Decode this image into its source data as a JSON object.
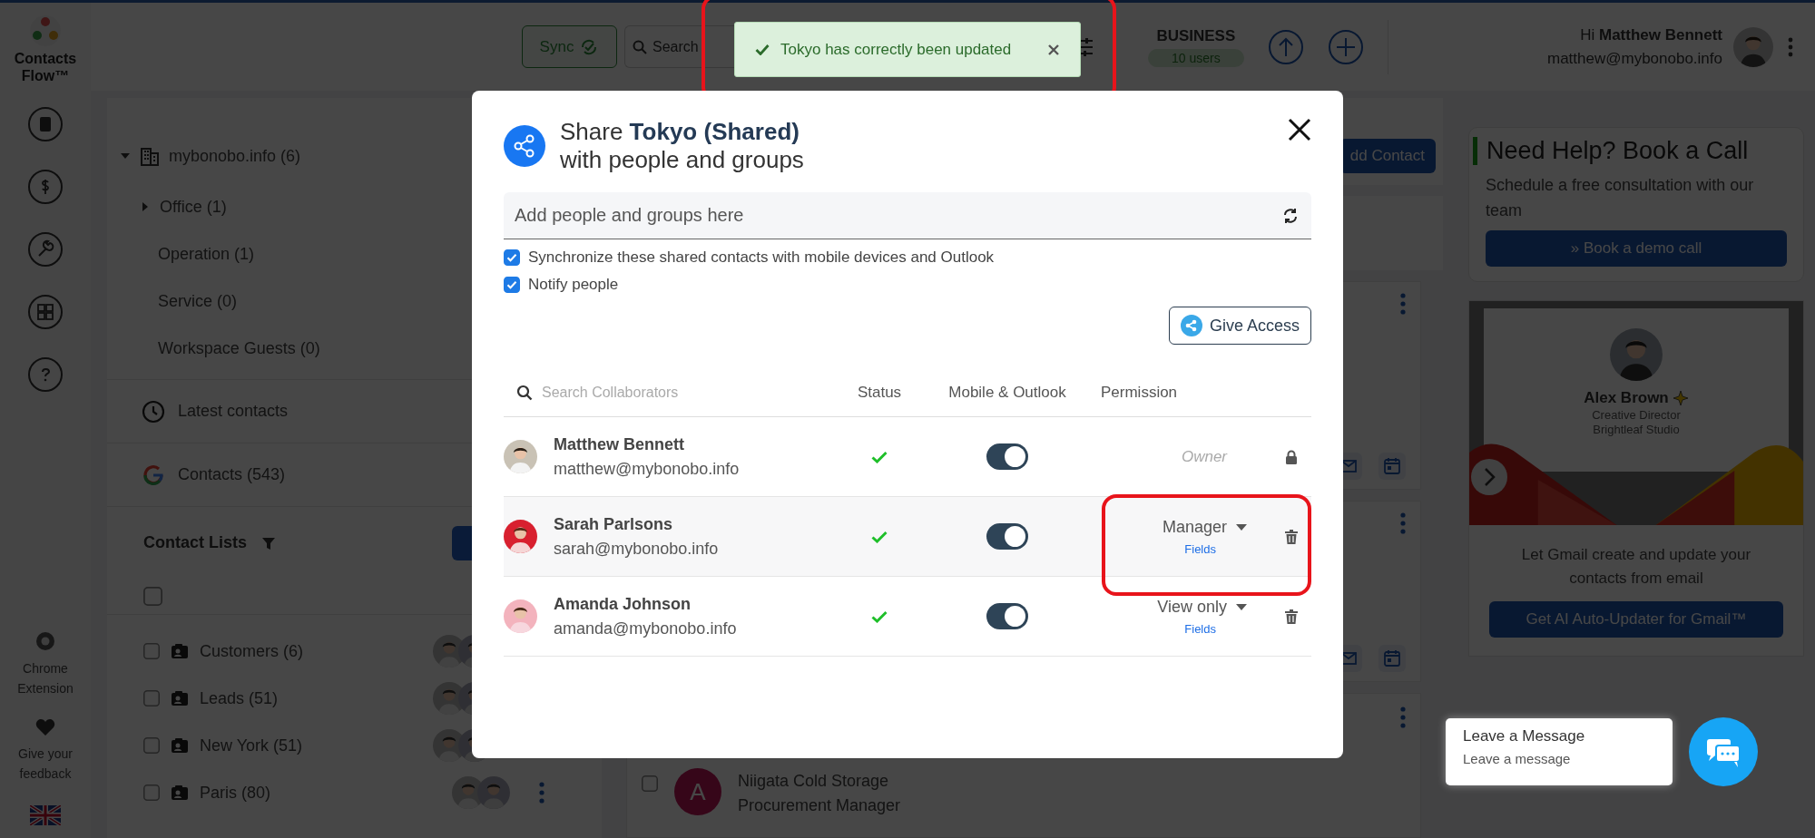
{
  "rail": {
    "logo": "Contacts Flow™",
    "extension": "Chrome Extension",
    "feedback": "Give your feedback"
  },
  "topbar": {
    "sync": "Sync",
    "search_placeholder": "Search",
    "plan": "BUSINESS",
    "users": "10 users",
    "greeting": "Hi **Matthew Bennett**",
    "email": "matthew@mybonobo.info"
  },
  "toast": {
    "message": "Tokyo has correctly been updated",
    "highlighted": true
  },
  "workspace": {
    "label": "mybonobo.info (6)",
    "expanded": true,
    "children": [
      {
        "label": "Office (1)",
        "kind": "branch"
      },
      {
        "label": "Operation (1)",
        "kind": "leaf"
      },
      {
        "label": "Service (0)",
        "kind": "leaf"
      },
      {
        "label": "Workspace Guests (0)",
        "kind": "leaf"
      }
    ]
  },
  "latest_contacts": "Latest contacts",
  "google_contacts": "Contacts (543)",
  "contact_lists": {
    "title": "Contact Lists",
    "all_checked": false,
    "rows": [
      {
        "label": "Customers (6)",
        "checked": false
      },
      {
        "label": "Leads (51)",
        "checked": false
      },
      {
        "label": "New York (51)",
        "checked": false
      },
      {
        "label": "Paris (80)",
        "checked": false
      }
    ]
  },
  "main": {
    "add_contact": "dd Contact",
    "contact": {
      "checked": false,
      "initial": "A",
      "company": "Niigata Cold Storage",
      "job_title": "Procurement Manager"
    }
  },
  "modal": {
    "title": "Share **Tokyo (Shared)**",
    "subtitle": "with people and groups",
    "add_placeholder": "Add people and groups here",
    "options": [
      {
        "label": "Synchronize these shared contacts with mobile devices and Outlook",
        "checked": true
      },
      {
        "label": "Notify people",
        "checked": true
      }
    ],
    "give_access": "Give Access",
    "search_placeholder": "Search Collaborators",
    "columns": [
      "Status",
      "Mobile & Outlook",
      "Permission"
    ],
    "collaborators": [
      {
        "name": "Matthew Bennett",
        "email": "matthew@mybonobo.info",
        "active": true,
        "sync_on": true,
        "kind": "owner",
        "permission": "Owner",
        "highlighted": false,
        "framed": false
      },
      {
        "name": "Sarah Parlsons",
        "email": "sarah@mybonobo.info",
        "active": true,
        "sync_on": true,
        "kind": "member",
        "permission": "Manager",
        "fields": "Fields",
        "highlighted": true,
        "framed": true
      },
      {
        "name": "Amanda Johnson",
        "email": "amanda@mybonobo.info",
        "active": true,
        "sync_on": true,
        "kind": "member",
        "permission": "View only",
        "fields": "Fields",
        "highlighted": false,
        "framed": false
      }
    ]
  },
  "help": {
    "title": "Need Help? Book a Call",
    "text": "Schedule a free consultation with our team",
    "button": "» Book a demo call"
  },
  "promo": {
    "card_name": "Alex Brown",
    "card_role": "Creative Director",
    "card_company": "Brightleaf Studio",
    "text": "Let Gmail create and update your contacts from email",
    "button": "Get AI Auto-Updater for Gmail™"
  },
  "chat": {
    "title": "Leave a Message",
    "subtitle": "Leave a message"
  }
}
